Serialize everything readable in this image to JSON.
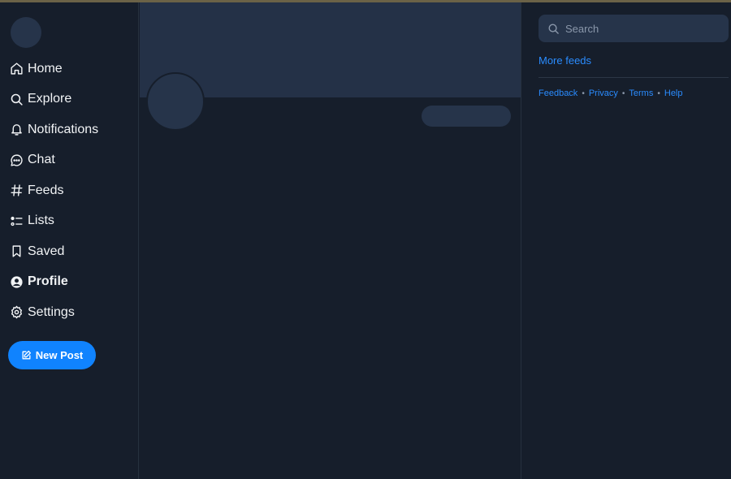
{
  "nav": {
    "items": [
      {
        "label": "Home",
        "icon": "home-icon"
      },
      {
        "label": "Explore",
        "icon": "search-icon"
      },
      {
        "label": "Notifications",
        "icon": "bell-icon"
      },
      {
        "label": "Chat",
        "icon": "chat-icon"
      },
      {
        "label": "Feeds",
        "icon": "hash-icon"
      },
      {
        "label": "Lists",
        "icon": "list-icon"
      },
      {
        "label": "Saved",
        "icon": "bookmark-icon"
      },
      {
        "label": "Profile",
        "icon": "user-circle-icon",
        "active": true
      },
      {
        "label": "Settings",
        "icon": "gear-icon"
      }
    ],
    "new_post_label": "New Post"
  },
  "search": {
    "placeholder": "Search"
  },
  "right": {
    "more_feeds": "More feeds",
    "footer_links": [
      "Feedback",
      "Privacy",
      "Terms",
      "Help"
    ],
    "separator": "•"
  },
  "colors": {
    "background": "#161e2b",
    "accent": "#1083fe",
    "link": "#2a8cff",
    "skeleton": "#26344a",
    "banner": "#243147"
  }
}
